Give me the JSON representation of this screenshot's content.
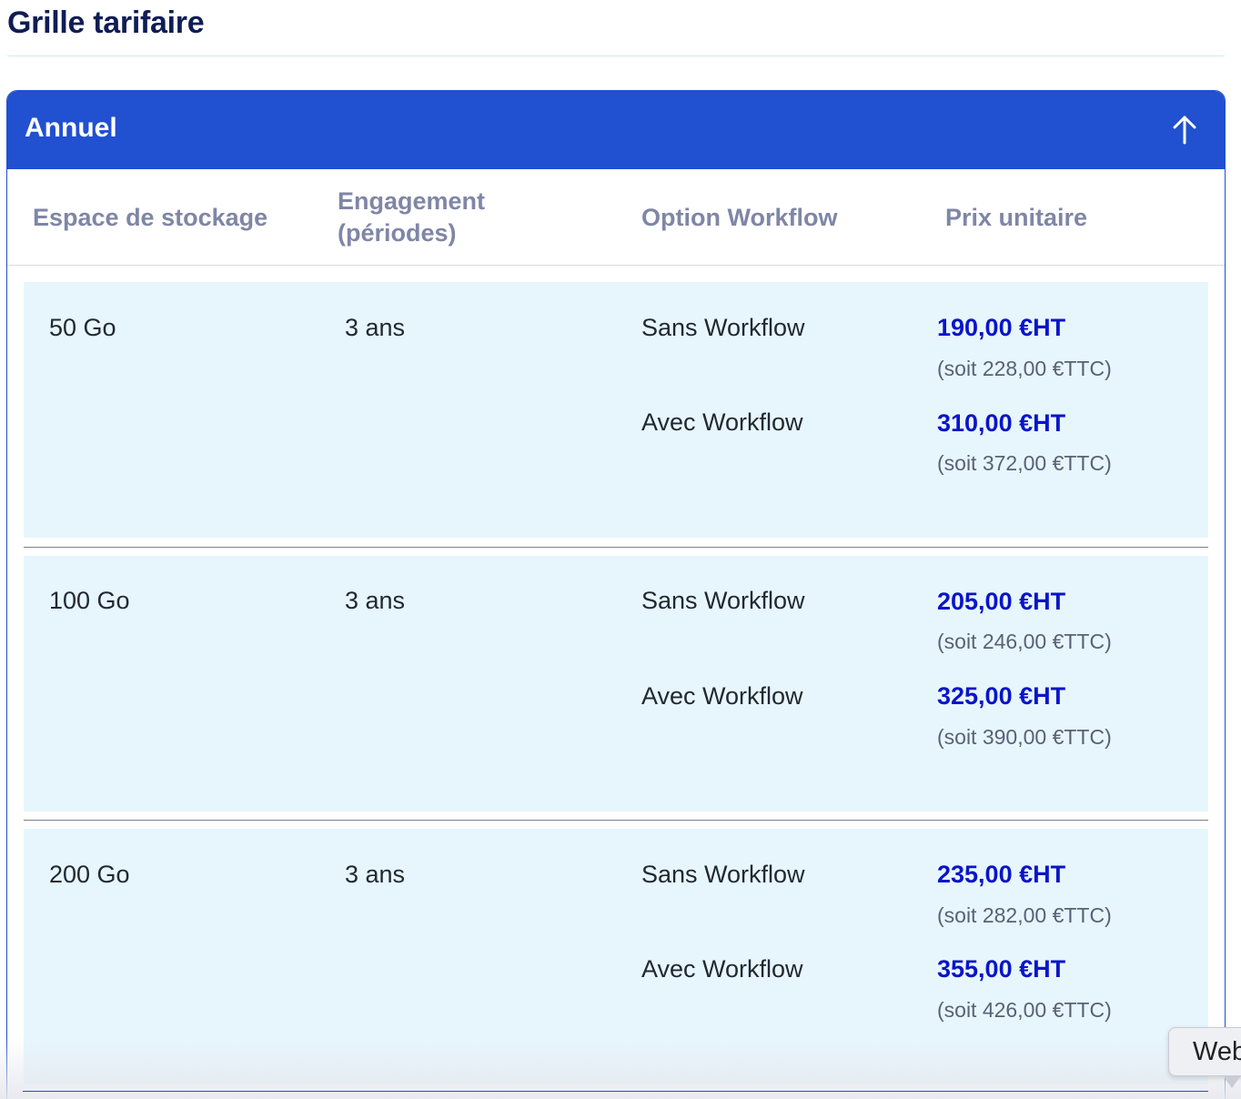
{
  "page_title": "Grille tarifaire",
  "accordion": {
    "title": "Annuel",
    "toggle_icon": "arrow-up-icon"
  },
  "columns": {
    "storage": "Espace de stockage",
    "engagement_line1": "Engagement",
    "engagement_line2": "(périodes)",
    "workflow": "Option Workflow",
    "price": "Prix unitaire"
  },
  "rows": [
    {
      "storage": "50 Go",
      "engagement": "3 ans",
      "options": [
        {
          "label": "Sans Workflow",
          "price_ht": "190,00 €HT",
          "price_ttc": "(soit 228,00 €TTC)"
        },
        {
          "label": "Avec Workflow",
          "price_ht": "310,00 €HT",
          "price_ttc": "(soit 372,00 €TTC)"
        }
      ]
    },
    {
      "storage": "100 Go",
      "engagement": "3 ans",
      "options": [
        {
          "label": "Sans Workflow",
          "price_ht": "205,00 €HT",
          "price_ttc": "(soit 246,00 €TTC)"
        },
        {
          "label": "Avec Workflow",
          "price_ht": "325,00 €HT",
          "price_ttc": "(soit 390,00 €TTC)"
        }
      ]
    },
    {
      "storage": "200 Go",
      "engagement": "3 ans",
      "options": [
        {
          "label": "Sans Workflow",
          "price_ht": "235,00 €HT",
          "price_ttc": "(soit 282,00 €TTC)"
        },
        {
          "label": "Avec Workflow",
          "price_ht": "355,00 €HT",
          "price_ttc": "(soit 426,00 €TTC)"
        }
      ]
    }
  ],
  "tooltip": {
    "text": "Web"
  },
  "colors": {
    "header_bg": "#2150d0",
    "row_bg": "#e7f6fd",
    "price": "#0a14c8",
    "title": "#0f1d55"
  }
}
